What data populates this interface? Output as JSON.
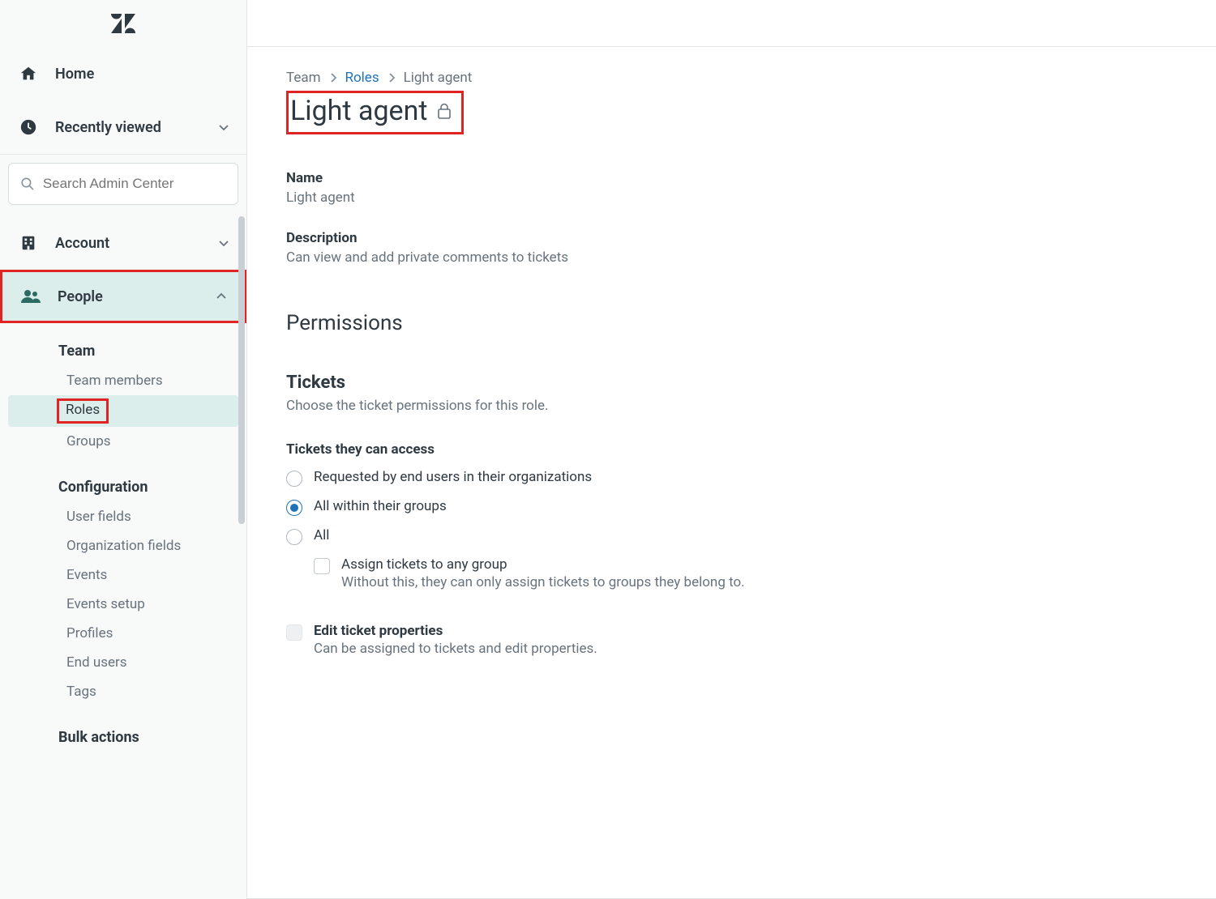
{
  "sidebar": {
    "home_label": "Home",
    "recent_label": "Recently viewed",
    "search_placeholder": "Search Admin Center",
    "sections": {
      "account": {
        "label": "Account"
      },
      "people": {
        "label": "People"
      }
    },
    "people_sub": {
      "team_heading": "Team",
      "team_members": "Team members",
      "roles": "Roles",
      "groups": "Groups",
      "config_heading": "Configuration",
      "user_fields": "User fields",
      "org_fields": "Organization fields",
      "events": "Events",
      "events_setup": "Events setup",
      "profiles": "Profiles",
      "end_users": "End users",
      "tags": "Tags",
      "bulk_heading": "Bulk actions"
    }
  },
  "breadcrumb": {
    "team": "Team",
    "roles": "Roles",
    "current": "Light agent"
  },
  "page": {
    "title": "Light agent",
    "name_label": "Name",
    "name_value": "Light agent",
    "desc_label": "Description",
    "desc_value": "Can view and add private comments to tickets",
    "permissions_title": "Permissions",
    "tickets_title": "Tickets",
    "tickets_desc": "Choose the ticket permissions for this role.",
    "access_label": "Tickets they can access",
    "radio_org": "Requested by end users in their organizations",
    "radio_groups": "All within their groups",
    "radio_all": "All",
    "assign_cb_label": "Assign tickets to any group",
    "assign_cb_sub": "Without this, they can only assign tickets to groups they belong to.",
    "edit_cb_label": "Edit ticket properties",
    "edit_cb_sub": "Can be assigned to tickets and edit properties."
  }
}
